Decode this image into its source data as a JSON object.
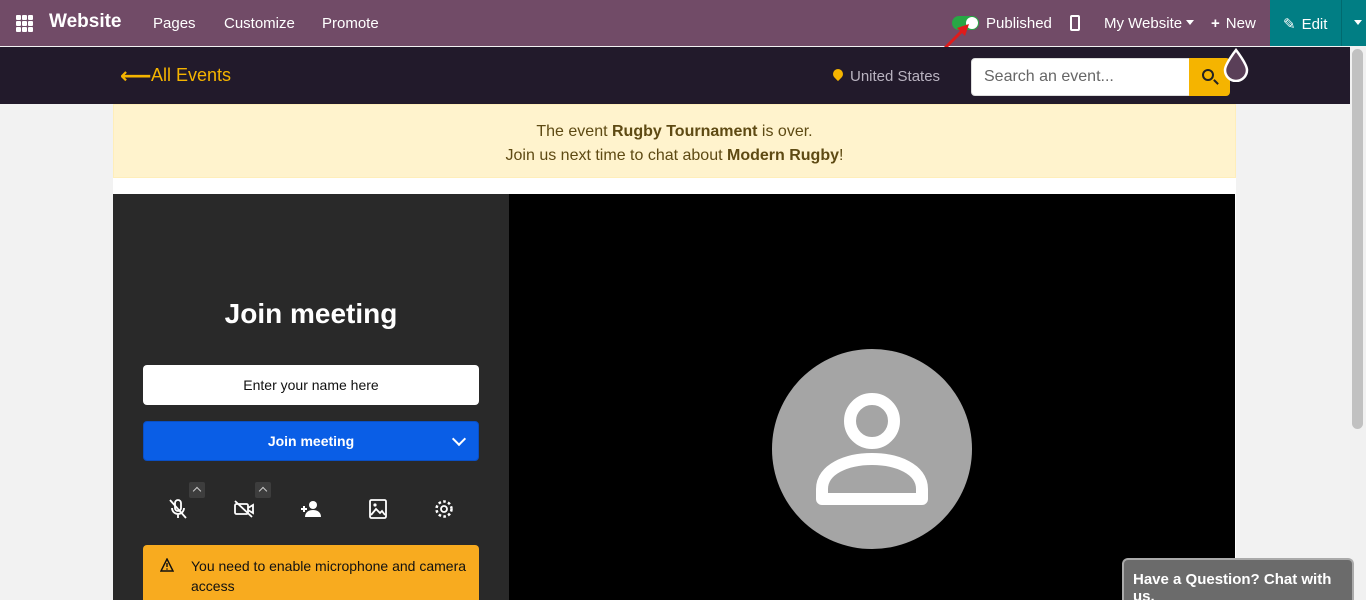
{
  "topbar": {
    "brand": "Website",
    "menu": [
      "Pages",
      "Customize",
      "Promote"
    ],
    "published_label": "Published",
    "my_website_label": "My Website",
    "new_label": "New",
    "edit_label": "Edit",
    "bg_color": "#714b67",
    "edit_color": "#017e84"
  },
  "event_nav": {
    "back_label": "All Events",
    "country": "United States",
    "search_placeholder": "Search an event...",
    "accent_color": "#f5b400"
  },
  "alert": {
    "line1_prefix": "The event ",
    "line1_event": "Rugby Tournament",
    "line1_suffix": " is over.",
    "line2_prefix": "Join us next time to chat about ",
    "line2_topic": "Modern Rugby",
    "line2_suffix": "!"
  },
  "meeting": {
    "title": "Join meeting",
    "name_placeholder": "Enter your name here",
    "join_label": "Join meeting",
    "controls": [
      "mic-off-icon",
      "camera-off-icon",
      "invite-person-icon",
      "background-image-icon",
      "settings-gear-icon"
    ],
    "warning": "You need to enable microphone and camera access"
  },
  "chat": {
    "label": "Have a Question? Chat with us."
  }
}
